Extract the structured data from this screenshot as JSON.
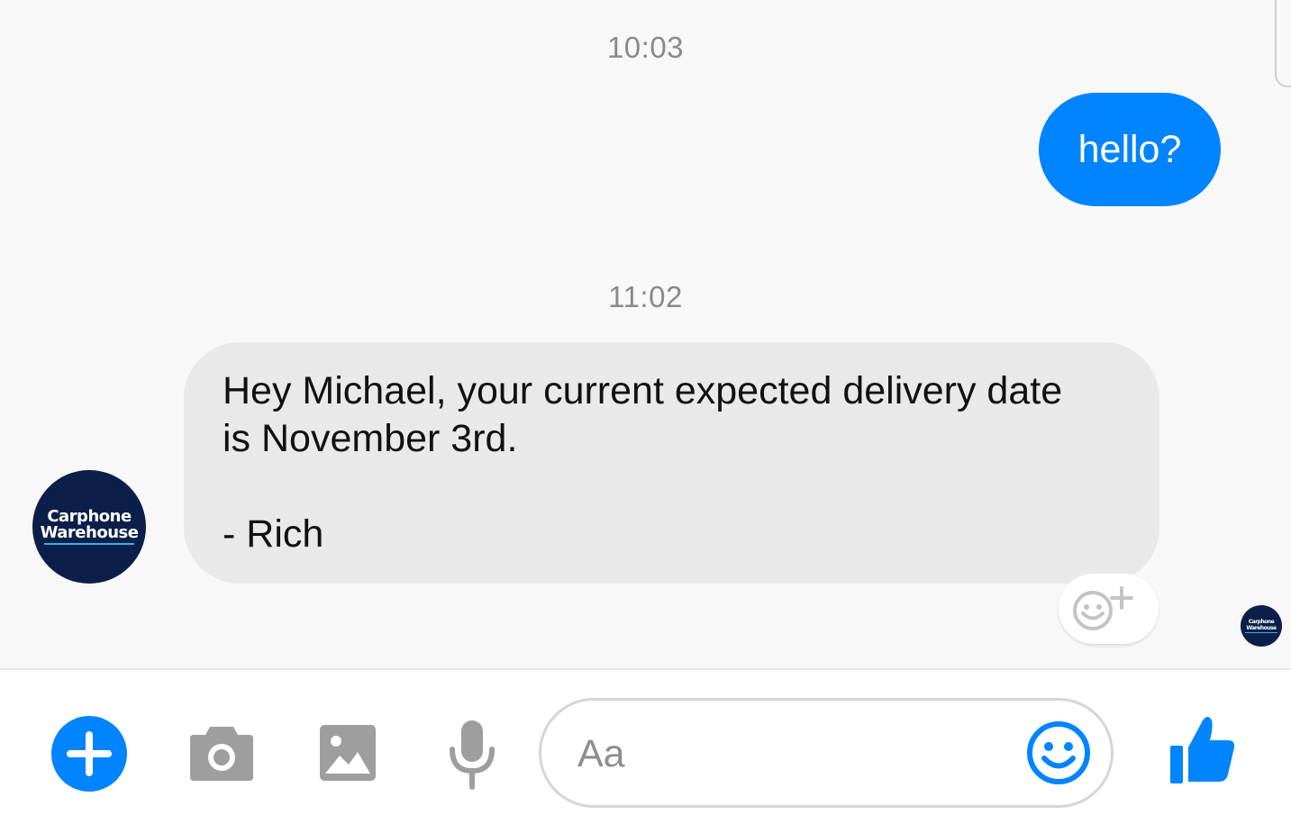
{
  "thread": {
    "timestamps": [
      "10:03",
      "11:02"
    ],
    "messages": [
      {
        "direction": "outgoing",
        "text": "hello?"
      },
      {
        "direction": "incoming",
        "sender": "Carphone Warehouse",
        "lines": [
          "Hey Michael, your current expected delivery date",
          "is November 3rd.",
          "",
          "- Rich"
        ]
      }
    ],
    "avatar": {
      "line1": "Carphone",
      "line2": "Warehouse"
    }
  },
  "composer": {
    "placeholder": "Aa"
  },
  "colors": {
    "accent": "#0084ff",
    "incoming_bubble": "#e9e9e9",
    "avatar_bg": "#0c1f4a",
    "avatar_underline": "#2bb7e6",
    "background": "#f8f8f8"
  },
  "icons": {
    "add": "plus-icon",
    "camera": "camera-icon",
    "gallery": "image-icon",
    "voice": "microphone-icon",
    "emoji": "emoji-icon",
    "like": "thumbs-up-icon",
    "reaction": "add-reaction-icon"
  }
}
